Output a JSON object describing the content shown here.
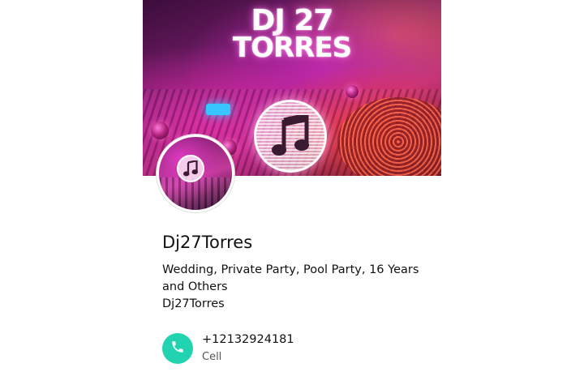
{
  "cover": {
    "title_line1": "DJ 27",
    "title_line2": "TORRES",
    "badge_icon": "music-note-icon",
    "led_color": "#37c6ff"
  },
  "avatar": {
    "icon": "music-note-icon"
  },
  "profile": {
    "name": "Dj27Torres",
    "description": "Wedding, Private Party, Pool Party, 16 Years and Others",
    "handle": "Dj27Torres"
  },
  "contact": {
    "phone_icon": "phone-icon",
    "phone_number": "+12132924181",
    "phone_type": "Cell",
    "accent_color": "#22d3b1"
  }
}
